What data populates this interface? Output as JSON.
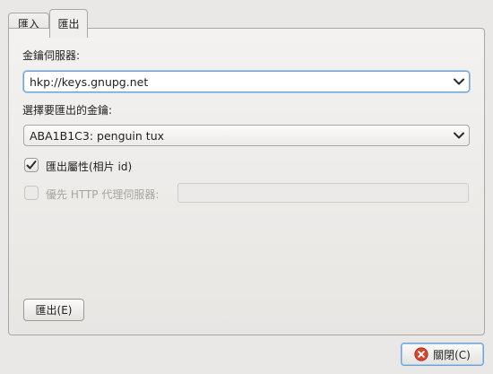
{
  "tabs": {
    "import_label": "匯入",
    "export_label": "匯出"
  },
  "keyserver": {
    "label": "金鑰伺服器:",
    "selected": "hkp://keys.gnupg.net"
  },
  "key_select": {
    "label": "選擇要匯出的金鑰:",
    "selected": "ABA1B1C3: penguin tux"
  },
  "export_attributes": {
    "label": "匯出屬性(相片 id)",
    "checked": true
  },
  "http_proxy": {
    "label": "優先 HTTP 代理伺服器:",
    "checked": false,
    "value": ""
  },
  "actions": {
    "export_label": "匯出(E)",
    "close_label": "關閉(C)"
  },
  "colors": {
    "focus_border": "#6fa3d6",
    "close_icon": "#d9442f",
    "window_bg": "#e9e8e6"
  },
  "icons": {
    "close": "close-circle-icon",
    "dropdown": "chevron-down-icon",
    "check": "checkmark-icon"
  }
}
